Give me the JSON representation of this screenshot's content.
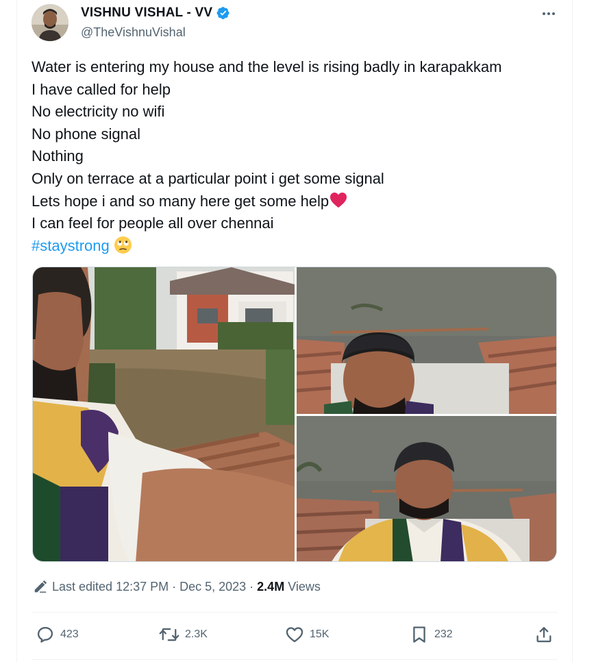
{
  "author": {
    "display_name": "VISHNU VISHAL - VV",
    "handle": "@TheVishnuVishal",
    "verified": true
  },
  "tweet": {
    "lines": [
      "Water is entering my house and the level is rising badly in karapakkam",
      "I have called for help",
      "No electricity no wifi",
      "No phone signal",
      "Nothing",
      "Only on terrace at a particular point i get some signal",
      "Lets hope i and so many here get some help",
      "I can feel for people all over chennai"
    ],
    "hashtag": "#staystrong",
    "heart_emoji": "heart-emoji",
    "face_emoji": "face-with-rolling-eyes-emoji"
  },
  "media": {
    "count": 3,
    "items": [
      "flooded-street-selfie",
      "rooftop-selfie-top",
      "rooftop-selfie-bottom"
    ]
  },
  "meta": {
    "edited_label": "Last edited 12:37 PM · Dec 5, 2023 ·",
    "views_count": "2.4M",
    "views_label": "Views"
  },
  "actions": {
    "reply_count": "423",
    "repost_count": "2.3K",
    "like_count": "15K",
    "bookmark_count": "232"
  },
  "colors": {
    "accent": "#1d9bf0",
    "secondary_text": "#536471",
    "heart": "#e0245e"
  }
}
